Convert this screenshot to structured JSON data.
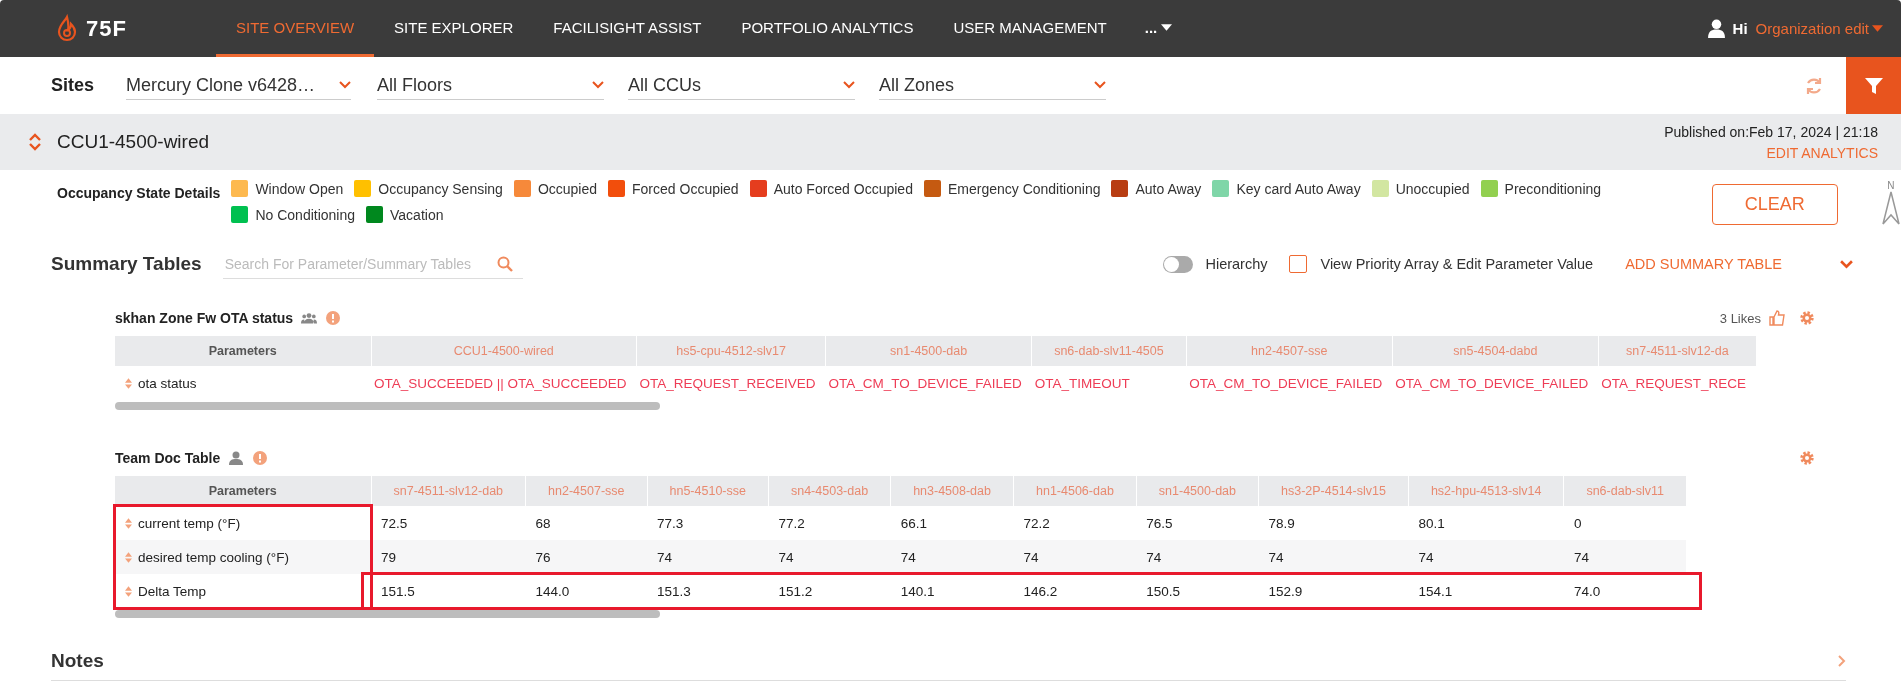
{
  "header": {
    "logo": "75F",
    "nav": [
      {
        "label": "SITE OVERVIEW",
        "selected": true
      },
      {
        "label": "SITE EXPLORER",
        "selected": false
      },
      {
        "label": "FACILISIGHT ASSIST",
        "selected": false
      },
      {
        "label": "PORTFOLIO ANALYTICS",
        "selected": false
      },
      {
        "label": "USER MANAGEMENT",
        "selected": false
      }
    ],
    "more": "...",
    "greeting": "Hi",
    "user": "Organization edit"
  },
  "filters": {
    "label": "Sites",
    "dropdowns": [
      "Mercury Clone v6428…",
      "All Floors",
      "All CCUs",
      "All Zones"
    ]
  },
  "ccu_bar": {
    "title": "CCU1-4500-wired",
    "published": "Published on:Feb 17, 2024 | 21:18",
    "edit_link": "EDIT ANALYTICS"
  },
  "legend": {
    "title": "Occupancy State Details",
    "items": [
      {
        "label": "Window Open",
        "color": "#fdb94f"
      },
      {
        "label": "Occupancy Sensing",
        "color": "#ffc000"
      },
      {
        "label": "Occupied",
        "color": "#f6893a"
      },
      {
        "label": "Forced Occupied",
        "color": "#f24e0c"
      },
      {
        "label": "Auto Forced Occupied",
        "color": "#e53d1e"
      },
      {
        "label": "Emergency Conditioning",
        "color": "#c55a11"
      },
      {
        "label": "Auto Away",
        "color": "#b83d12"
      },
      {
        "label": "Key card Auto Away",
        "color": "#7fd6a8"
      },
      {
        "label": "Unoccupied",
        "color": "#d2e6a1"
      },
      {
        "label": "Preconditioning",
        "color": "#92d050"
      },
      {
        "label": "No Conditioning",
        "color": "#00c050"
      },
      {
        "label": "Vacation",
        "color": "#00881e"
      }
    ],
    "clear_button": "CLEAR",
    "compass": "N"
  },
  "summary": {
    "title": "Summary Tables",
    "search_placeholder": "Search For Parameter/Summary Tables",
    "hierarchy": {
      "label": "Hierarchy",
      "on": false
    },
    "priority": {
      "label": "View Priority Array & Edit Parameter Value",
      "checked": false
    },
    "add_button": "ADD SUMMARY TABLE"
  },
  "tables": [
    {
      "title": "skhan Zone Fw OTA status",
      "kind": "group",
      "likes": "3 Likes",
      "label_highlight": false,
      "columns": [
        "Parameters",
        "CCU1-4500-wired",
        "hs5-cpu-4512-slv17",
        "sn1-4500-dab",
        "sn6-dab-slv11-4505",
        "hn2-4507-sse",
        "sn5-4504-dabd",
        "sn7-4511-slv12-da"
      ],
      "rows": [
        {
          "label": "ota status",
          "highlighted": false,
          "values": [
            "OTA_SUCCEEDED || OTA_SUCCEEDED",
            "OTA_REQUEST_RECEIVED",
            "OTA_CM_TO_DEVICE_FAILED",
            "OTA_TIMEOUT",
            "OTA_CM_TO_DEVICE_FAILED",
            "OTA_CM_TO_DEVICE_FAILED",
            "OTA_REQUEST_RECE"
          ]
        }
      ]
    },
    {
      "title": "Team Doc Table",
      "kind": "person",
      "label_highlight": true,
      "columns": [
        "Parameters",
        "sn7-4511-slv12-dab",
        "hn2-4507-sse",
        "hn5-4510-sse",
        "sn4-4503-dab",
        "hn3-4508-dab",
        "hn1-4506-dab",
        "sn1-4500-dab",
        "hs3-2P-4514-slv15",
        "hs2-hpu-4513-slv14",
        "sn6-dab-slv11"
      ],
      "rows": [
        {
          "label": "current temp  (°F)",
          "highlighted": false,
          "values": [
            "72.5",
            "68",
            "77.3",
            "77.2",
            "66.1",
            "72.2",
            "76.5",
            "78.9",
            "80.1",
            "0"
          ]
        },
        {
          "label": "desired temp cooling  (°F)",
          "highlighted": false,
          "values": [
            "79",
            "76",
            "74",
            "74",
            "74",
            "74",
            "74",
            "74",
            "74",
            "74"
          ]
        },
        {
          "label": "Delta Temp",
          "highlighted": true,
          "values": [
            "151.5",
            "144.0",
            "151.3",
            "151.2",
            "140.1",
            "146.2",
            "150.5",
            "152.9",
            "154.1",
            "74.0"
          ]
        }
      ]
    }
  ],
  "notes": {
    "title": "Notes"
  }
}
